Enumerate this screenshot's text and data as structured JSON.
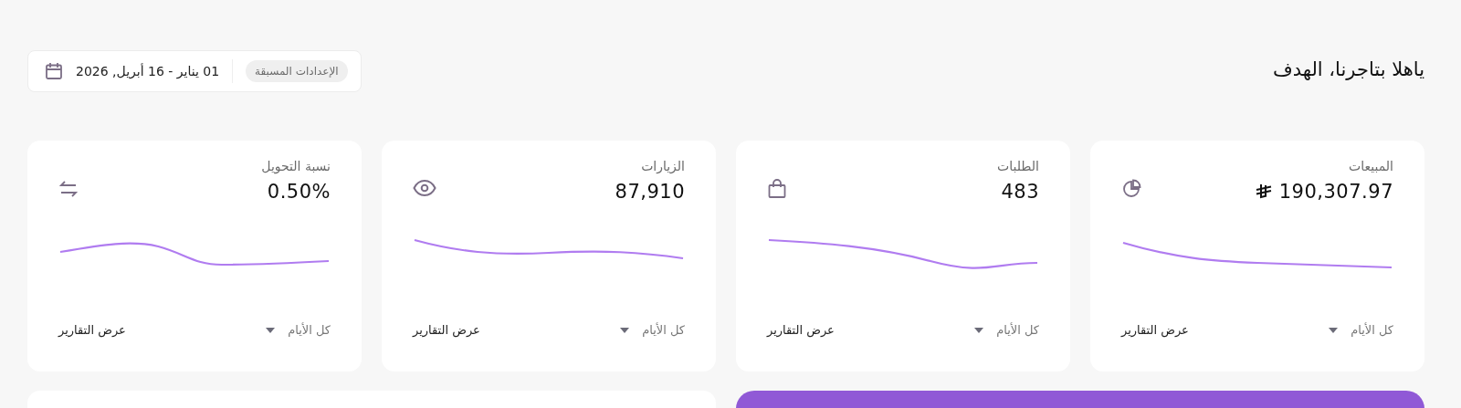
{
  "header": {
    "title": "ياهلا بتاجرنا، الهدف",
    "preset": "الإعدادات المسبقة",
    "date_range": "01 يناير - 16 أبريل, 2026"
  },
  "cards": [
    {
      "kind": "sales",
      "label": "المبيعات",
      "value": "190,307.97",
      "period": "كل الأيام",
      "link": "عرض التقارير"
    },
    {
      "kind": "orders",
      "label": "الطلبات",
      "value": "483",
      "period": "كل الأيام",
      "link": "عرض التقارير"
    },
    {
      "kind": "visits",
      "label": "الزيارات",
      "value": "87,910",
      "period": "كل الأيام",
      "link": "عرض التقارير"
    },
    {
      "kind": "conversion",
      "label": "نسبة التحويل",
      "value": "0.50%",
      "period": "كل الأيام",
      "link": "عرض التقارير"
    }
  ]
}
